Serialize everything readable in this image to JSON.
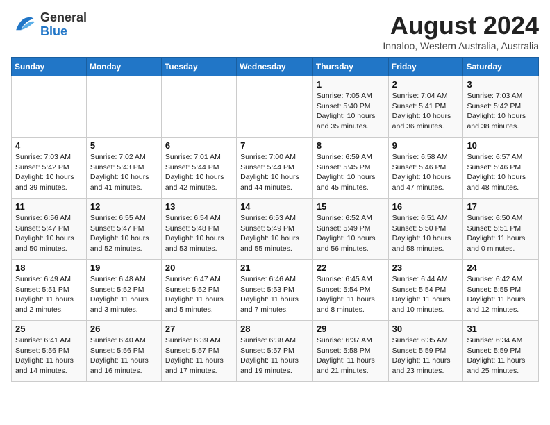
{
  "header": {
    "logo": {
      "line1": "General",
      "line2": "Blue"
    },
    "title": "August 2024",
    "subtitle": "Innaloo, Western Australia, Australia"
  },
  "weekdays": [
    "Sunday",
    "Monday",
    "Tuesday",
    "Wednesday",
    "Thursday",
    "Friday",
    "Saturday"
  ],
  "weeks": [
    [
      {
        "day": "",
        "info": ""
      },
      {
        "day": "",
        "info": ""
      },
      {
        "day": "",
        "info": ""
      },
      {
        "day": "",
        "info": ""
      },
      {
        "day": "1",
        "info": "Sunrise: 7:05 AM\nSunset: 5:40 PM\nDaylight: 10 hours\nand 35 minutes."
      },
      {
        "day": "2",
        "info": "Sunrise: 7:04 AM\nSunset: 5:41 PM\nDaylight: 10 hours\nand 36 minutes."
      },
      {
        "day": "3",
        "info": "Sunrise: 7:03 AM\nSunset: 5:42 PM\nDaylight: 10 hours\nand 38 minutes."
      }
    ],
    [
      {
        "day": "4",
        "info": "Sunrise: 7:03 AM\nSunset: 5:42 PM\nDaylight: 10 hours\nand 39 minutes."
      },
      {
        "day": "5",
        "info": "Sunrise: 7:02 AM\nSunset: 5:43 PM\nDaylight: 10 hours\nand 41 minutes."
      },
      {
        "day": "6",
        "info": "Sunrise: 7:01 AM\nSunset: 5:44 PM\nDaylight: 10 hours\nand 42 minutes."
      },
      {
        "day": "7",
        "info": "Sunrise: 7:00 AM\nSunset: 5:44 PM\nDaylight: 10 hours\nand 44 minutes."
      },
      {
        "day": "8",
        "info": "Sunrise: 6:59 AM\nSunset: 5:45 PM\nDaylight: 10 hours\nand 45 minutes."
      },
      {
        "day": "9",
        "info": "Sunrise: 6:58 AM\nSunset: 5:46 PM\nDaylight: 10 hours\nand 47 minutes."
      },
      {
        "day": "10",
        "info": "Sunrise: 6:57 AM\nSunset: 5:46 PM\nDaylight: 10 hours\nand 48 minutes."
      }
    ],
    [
      {
        "day": "11",
        "info": "Sunrise: 6:56 AM\nSunset: 5:47 PM\nDaylight: 10 hours\nand 50 minutes."
      },
      {
        "day": "12",
        "info": "Sunrise: 6:55 AM\nSunset: 5:47 PM\nDaylight: 10 hours\nand 52 minutes."
      },
      {
        "day": "13",
        "info": "Sunrise: 6:54 AM\nSunset: 5:48 PM\nDaylight: 10 hours\nand 53 minutes."
      },
      {
        "day": "14",
        "info": "Sunrise: 6:53 AM\nSunset: 5:49 PM\nDaylight: 10 hours\nand 55 minutes."
      },
      {
        "day": "15",
        "info": "Sunrise: 6:52 AM\nSunset: 5:49 PM\nDaylight: 10 hours\nand 56 minutes."
      },
      {
        "day": "16",
        "info": "Sunrise: 6:51 AM\nSunset: 5:50 PM\nDaylight: 10 hours\nand 58 minutes."
      },
      {
        "day": "17",
        "info": "Sunrise: 6:50 AM\nSunset: 5:51 PM\nDaylight: 11 hours\nand 0 minutes."
      }
    ],
    [
      {
        "day": "18",
        "info": "Sunrise: 6:49 AM\nSunset: 5:51 PM\nDaylight: 11 hours\nand 2 minutes."
      },
      {
        "day": "19",
        "info": "Sunrise: 6:48 AM\nSunset: 5:52 PM\nDaylight: 11 hours\nand 3 minutes."
      },
      {
        "day": "20",
        "info": "Sunrise: 6:47 AM\nSunset: 5:52 PM\nDaylight: 11 hours\nand 5 minutes."
      },
      {
        "day": "21",
        "info": "Sunrise: 6:46 AM\nSunset: 5:53 PM\nDaylight: 11 hours\nand 7 minutes."
      },
      {
        "day": "22",
        "info": "Sunrise: 6:45 AM\nSunset: 5:54 PM\nDaylight: 11 hours\nand 8 minutes."
      },
      {
        "day": "23",
        "info": "Sunrise: 6:44 AM\nSunset: 5:54 PM\nDaylight: 11 hours\nand 10 minutes."
      },
      {
        "day": "24",
        "info": "Sunrise: 6:42 AM\nSunset: 5:55 PM\nDaylight: 11 hours\nand 12 minutes."
      }
    ],
    [
      {
        "day": "25",
        "info": "Sunrise: 6:41 AM\nSunset: 5:56 PM\nDaylight: 11 hours\nand 14 minutes."
      },
      {
        "day": "26",
        "info": "Sunrise: 6:40 AM\nSunset: 5:56 PM\nDaylight: 11 hours\nand 16 minutes."
      },
      {
        "day": "27",
        "info": "Sunrise: 6:39 AM\nSunset: 5:57 PM\nDaylight: 11 hours\nand 17 minutes."
      },
      {
        "day": "28",
        "info": "Sunrise: 6:38 AM\nSunset: 5:57 PM\nDaylight: 11 hours\nand 19 minutes."
      },
      {
        "day": "29",
        "info": "Sunrise: 6:37 AM\nSunset: 5:58 PM\nDaylight: 11 hours\nand 21 minutes."
      },
      {
        "day": "30",
        "info": "Sunrise: 6:35 AM\nSunset: 5:59 PM\nDaylight: 11 hours\nand 23 minutes."
      },
      {
        "day": "31",
        "info": "Sunrise: 6:34 AM\nSunset: 5:59 PM\nDaylight: 11 hours\nand 25 minutes."
      }
    ]
  ]
}
